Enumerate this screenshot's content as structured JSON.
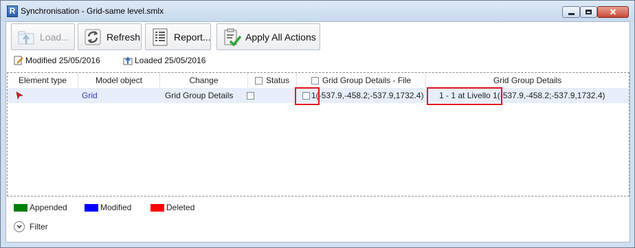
{
  "window": {
    "app_icon": "R",
    "title": "Synchronisation - Grid-same level.smlx",
    "icons": {
      "minimize": "minimize-icon",
      "maximize": "maximize-icon",
      "close": "close-icon"
    }
  },
  "toolbar": {
    "load": {
      "label": "Load...",
      "icon": "load-icon",
      "enabled": false
    },
    "refresh": {
      "label": "Refresh",
      "icon": "refresh-icon",
      "enabled": true
    },
    "report": {
      "label": "Report...",
      "icon": "report-icon",
      "enabled": true
    },
    "apply": {
      "label": "Apply All Actions",
      "icon": "apply-actions-icon",
      "enabled": true
    }
  },
  "meta": {
    "modified": "Modified 25/05/2016",
    "loaded": "Loaded 25/05/2016"
  },
  "grid": {
    "columns": [
      {
        "label": "Element type"
      },
      {
        "label": "Model object"
      },
      {
        "label": "Change"
      },
      {
        "label": "Status",
        "checkbox": true
      },
      {
        "label": "Grid Group Details - File",
        "checkbox": true
      },
      {
        "label": "Grid Group Details"
      }
    ],
    "rows": [
      {
        "element_type_icon": "grid-element-icon",
        "model_object": "Grid",
        "change": "Grid Group Details",
        "status_checked": false,
        "file_checked": false,
        "file_value": "1(-537.9,-458.2;-537.9,1732.4)",
        "details_value": "1 - 1 at Livello 1(-537.9,-458.2;-537.9,1732.4)"
      }
    ],
    "highlight_color": "#e0141a"
  },
  "legend": [
    {
      "label": "Appended",
      "color": "#008000"
    },
    {
      "label": "Modified",
      "color": "#0000ff"
    },
    {
      "label": "Deleted",
      "color": "#ff0000"
    }
  ],
  "filter": {
    "label": "Filter",
    "icon": "chevron-down-icon"
  }
}
